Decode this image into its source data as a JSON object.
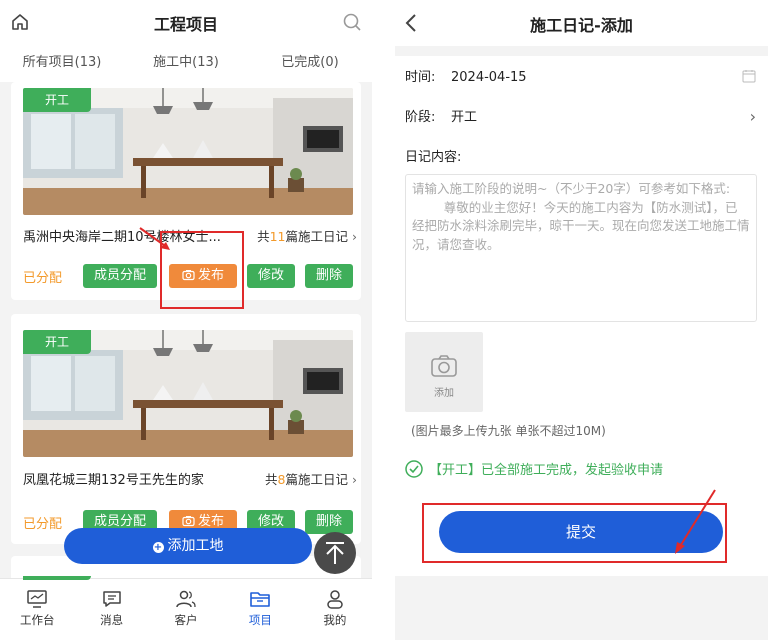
{
  "left": {
    "header": {
      "title": "工程项目"
    },
    "tabs": [
      {
        "label": "所有项目(13)"
      },
      {
        "label": "施工中(13)"
      },
      {
        "label": "已完成(0)"
      }
    ],
    "cards": [
      {
        "badge": "开工",
        "address": "禹洲中央海岸二期10号楼林女士...",
        "count_prefix": "共",
        "count_num": "11",
        "count_suffix": "篇施工日记",
        "status": "已分配",
        "btn_member": "成员分配",
        "btn_publish": "发布",
        "btn_edit": "修改",
        "btn_delete": "删除"
      },
      {
        "badge": "开工",
        "address": "凤凰花城三期132号王先生的家",
        "count_prefix": "共",
        "count_num": "8",
        "count_suffix": "篇施工日记",
        "status": "已分配",
        "btn_member": "成员分配",
        "btn_publish": "发布",
        "btn_edit": "修改",
        "btn_delete": "删除"
      }
    ],
    "fab_label": "添加工地",
    "tabbar": [
      {
        "label": "工作台",
        "icon": "monitor-icon"
      },
      {
        "label": "消息",
        "icon": "message-icon"
      },
      {
        "label": "客户",
        "icon": "users-icon"
      },
      {
        "label": "项目",
        "icon": "folder-icon",
        "active": true
      },
      {
        "label": "我的",
        "icon": "person-icon"
      }
    ]
  },
  "right": {
    "header": {
      "title": "施工日记-添加"
    },
    "time_label": "时间:",
    "time_value": "2024-04-15",
    "stage_label": "阶段:",
    "stage_value": "开工",
    "content_label": "日记内容:",
    "content_placeholder": "请输入施工阶段的说明~（不少于20字）可参考如下格式:\n        尊敬的业主您好！今天的施工内容为【防水测试】，已经把防水涂料涂刷完毕，晾干一天。现在向您发送工地施工情况，请您查收。",
    "upload_label": "添加",
    "upload_hint": "(图片最多上传九张 单张不超过10M)",
    "done_text": "【开工】已全部施工完成，发起验收申请",
    "submit_label": "提交"
  },
  "colors": {
    "primary": "#1f5ed8",
    "green": "#3fae5a",
    "orange": "#f08a3b",
    "highlight_red": "#e02a2a"
  }
}
